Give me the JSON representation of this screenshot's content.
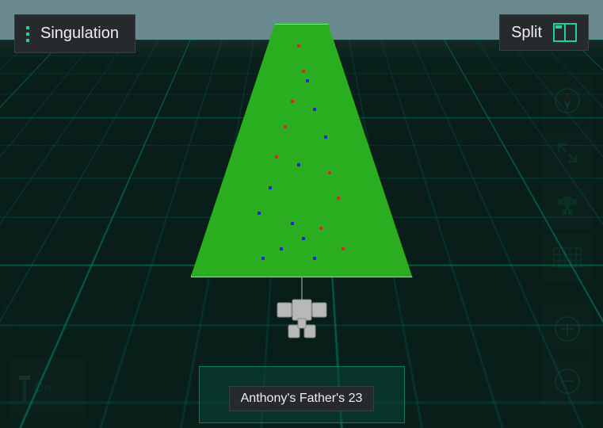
{
  "header": {
    "mode_label": "Singulation",
    "split_label": "Split"
  },
  "toggle": {
    "state_label": "On"
  },
  "field": {
    "name": "Anthony's Father's 23"
  },
  "tools": {
    "compass": "compass-icon",
    "expand": "expand-icon",
    "tractor_view": "tractor-icon",
    "keyboard": "keyboard-icon",
    "zoom_in": "zoom-in-icon",
    "zoom_out": "zoom-out-icon"
  },
  "colors": {
    "accent": "#1fd0a0",
    "panel": "#262a2c",
    "field": "#2aae1f"
  }
}
